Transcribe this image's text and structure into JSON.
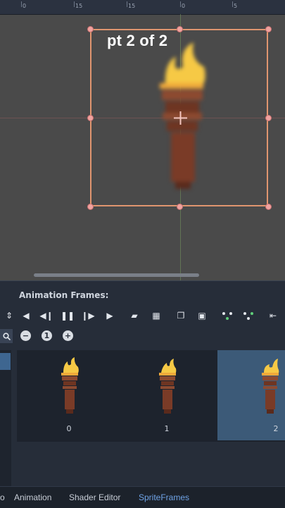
{
  "ruler": {
    "labels": [
      "0",
      "15",
      "15",
      "0",
      "5"
    ]
  },
  "overlay": {
    "caption": "pt 2 of 2"
  },
  "panel": {
    "title": "Animation Frames:",
    "frames": [
      {
        "index": "0"
      },
      {
        "index": "1"
      },
      {
        "index": "2"
      }
    ],
    "selected_frame": "2"
  },
  "toolbar_icons": [
    "spin-icon",
    "play-backwards-icon",
    "step-back-icon",
    "pause-icon",
    "step-forward-icon",
    "play-icon",
    "open-icon",
    "grid-icon",
    "copy-icon",
    "paste-icon",
    "move-left-icon",
    "move-right-icon",
    "delete-icon"
  ],
  "tabs": {
    "output": "o",
    "animation": "Animation",
    "shader_editor": "Shader Editor",
    "sprite_frames": "SpriteFrames"
  },
  "colors": {
    "accent": "#6fa3e6",
    "selection_box": "#e0956f",
    "selected_frame": "#3c5a78"
  }
}
